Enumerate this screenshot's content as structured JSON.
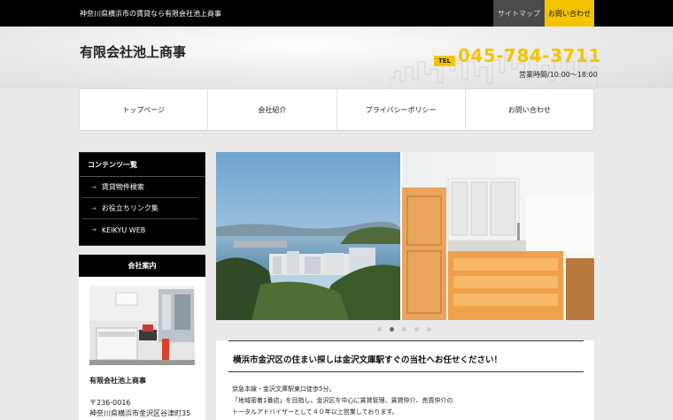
{
  "topbar": {
    "tagline": "神奈川県横浜市の賃貸なら有限会社池上商事",
    "sitemap": "サイトマップ",
    "contact": "お問い合わせ"
  },
  "header": {
    "company": "有限会社池上商事",
    "tel_label": "TEL",
    "tel_number": "045-784-3711",
    "hours": "営業時間/10:00～18:00"
  },
  "nav": [
    "トップページ",
    "会社紹介",
    "プライバシーポリシー",
    "お問い合わせ"
  ],
  "sidebar": {
    "contents_title": "コンテンツ一覧",
    "links": [
      "賃貸物件検索",
      "お役立ちリンク集",
      "KEIKYU WEB"
    ],
    "company_title": "会社案内",
    "company_name": "有限会社池上商事",
    "postal": "〒236-0016",
    "address": "神奈川県横浜市金沢区谷津町35"
  },
  "slideshow": {
    "dot_count": 5,
    "active_index": 1
  },
  "main": {
    "headline": "横浜市金沢区の住まい探しは金沢文庫駅すぐの当社へお任せください！",
    "lines": [
      "京急本線・金沢文庫駅東口徒歩5分。",
      "「地域密着1番店」を目指し、金沢区を中心に賃貸管理、賃貸仲介、売買仲介の",
      "トータルアドバイザーとして４０年以上営業しております。"
    ]
  },
  "colors": {
    "accent": "#f5c400",
    "dark": "#000000"
  }
}
